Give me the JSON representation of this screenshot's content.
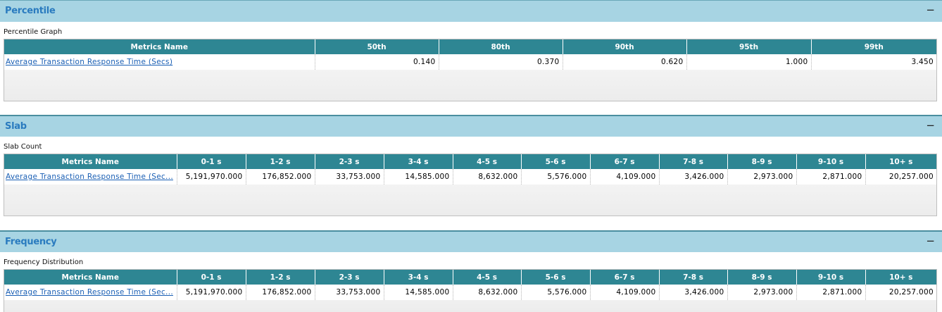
{
  "percentile": {
    "title": "Percentile",
    "collapse_symbol": "−",
    "sub_label": "Percentile Graph",
    "columns": [
      "Metrics Name",
      "50th",
      "80th",
      "90th",
      "95th",
      "99th"
    ],
    "row": {
      "name": "Average Transaction Response Time (Secs)",
      "values": [
        "0.140",
        "0.370",
        "0.620",
        "1.000",
        "3.450"
      ]
    }
  },
  "slab": {
    "title": "Slab",
    "collapse_symbol": "−",
    "sub_label": "Slab Count",
    "columns": [
      "Metrics Name",
      "0-1 s",
      "1-2 s",
      "2-3 s",
      "3-4 s",
      "4-5 s",
      "5-6 s",
      "6-7 s",
      "7-8 s",
      "8-9 s",
      "9-10 s",
      "10+ s"
    ],
    "row": {
      "name": "Average Transaction Response Time (Sec...",
      "values": [
        "5,191,970.000",
        "176,852.000",
        "33,753.000",
        "14,585.000",
        "8,632.000",
        "5,576.000",
        "4,109.000",
        "3,426.000",
        "2,973.000",
        "2,871.000",
        "20,257.000"
      ]
    }
  },
  "frequency": {
    "title": "Frequency",
    "collapse_symbol": "−",
    "sub_label": "Frequency Distribution",
    "columns": [
      "Metrics Name",
      "0-1 s",
      "1-2 s",
      "2-3 s",
      "3-4 s",
      "4-5 s",
      "5-6 s",
      "6-7 s",
      "7-8 s",
      "8-9 s",
      "9-10 s",
      "10+ s"
    ],
    "row": {
      "name": "Average Transaction Response Time (Sec...",
      "values": [
        "5,191,970.000",
        "176,852.000",
        "33,753.000",
        "14,585.000",
        "8,632.000",
        "5,576.000",
        "4,109.000",
        "3,426.000",
        "2,973.000",
        "2,871.000",
        "20,257.000"
      ]
    }
  }
}
